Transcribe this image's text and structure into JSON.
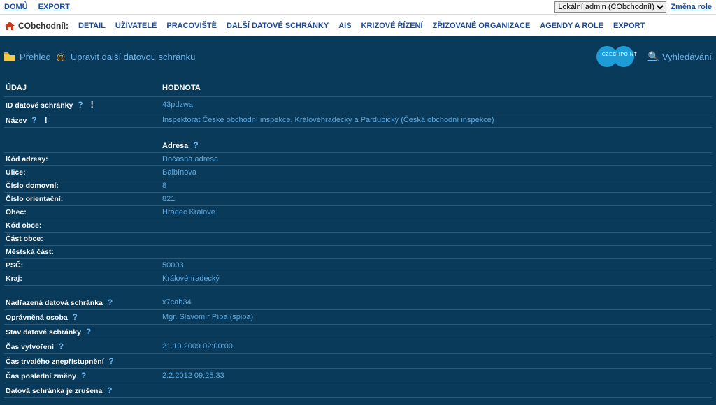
{
  "top": {
    "home": "DOMŮ",
    "export": "EXPORT",
    "role_selected": "Lokální admin (CObchodníI)",
    "change_role": "Změna role"
  },
  "nav": {
    "org": "CObchodníI:",
    "items": [
      "DETAIL",
      "UŽIVATELÉ",
      "PRACOVIŠTĚ",
      "DALŠÍ DATOVÉ SCHRÁNKY",
      "AIS",
      "KRIZOVÉ ŘÍZENÍ",
      "ZŘIZOVANÉ ORGANIZACE",
      "AGENDY A ROLE",
      "EXPORT"
    ]
  },
  "actions": {
    "overview": "Přehled",
    "edit": "Upravit další datovou schránku",
    "search": "Vyhledávání",
    "badge_text": "CZECHPOINT"
  },
  "table": {
    "header_label": "ÚDAJ",
    "header_value": "HODNOTA",
    "id_label": "ID datové schránky",
    "id_value": "43pdzwa",
    "name_label": "Název",
    "name_value": "Inspektorát České obchodní inspekce, Královéhradecký a Pardubický (Česká obchodní inspekce)",
    "address_label": "Adresa",
    "addr_code_label": "Kód adresy:",
    "addr_code_value": "Dočasná adresa",
    "street_label": "Ulice:",
    "street_value": "Balbínova",
    "houseno_label": "Číslo domovní:",
    "houseno_value": "8",
    "orientno_label": "Číslo orientační:",
    "orientno_value": "821",
    "city_label": "Obec:",
    "city_value": "Hradec Králové",
    "citycode_label": "Kód obce:",
    "citycode_value": "",
    "citypart_label": "Část obce:",
    "citypart_value": "",
    "district_label": "Městská část:",
    "district_value": "",
    "zip_label": "PSČ:",
    "zip_value": "50003",
    "region_label": "Kraj:",
    "region_value": "Královéhradecký",
    "parent_label": "Nadřazená datová schránka",
    "parent_value": "x7cab34",
    "auth_label": "Oprávněná osoba",
    "auth_value": "Mgr. Slavomír Pípa (spipa)",
    "status_label": "Stav datové schránky",
    "status_value": "",
    "created_label": "Čas vytvoření",
    "created_value": "21.10.2009 02:00:00",
    "perm_unavail_label": "Čas trvalého znepřístupnění",
    "perm_unavail_value": "",
    "lastchange_label": "Čas poslední změny",
    "lastchange_value": "2.2.2012 09:25:33",
    "cancelled_label": "Datová schránka je zrušena",
    "cancelled_value": ""
  }
}
